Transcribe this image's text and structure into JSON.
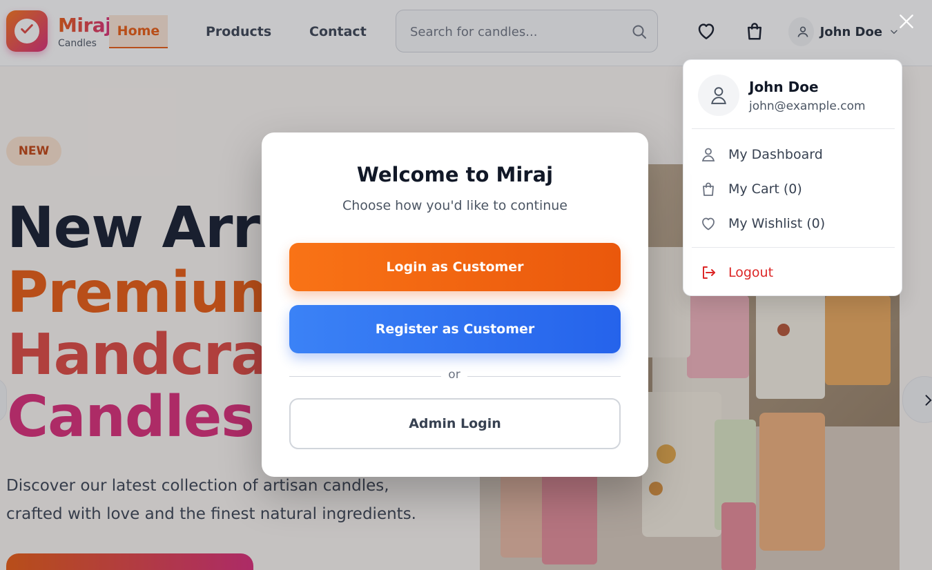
{
  "brand": {
    "name": "Miraj",
    "sub": "Candles"
  },
  "nav": {
    "home": "Home",
    "products": "Products",
    "contact": "Contact"
  },
  "search": {
    "placeholder": "Search for candles..."
  },
  "header": {
    "user_name": "John Doe"
  },
  "hero": {
    "badge": "NEW",
    "line1": "New Arrivals",
    "line2": "Premium",
    "line3": "Handcrafted",
    "line4": "Candles",
    "description": "Discover our latest collection of artisan candles, crafted with love and the finest natural ingredients."
  },
  "dropdown": {
    "name": "John Doe",
    "email": "john@example.com",
    "items": [
      {
        "label": "My Dashboard",
        "icon": "user-icon"
      },
      {
        "label": "My Cart (0)",
        "icon": "bag-icon"
      },
      {
        "label": "My Wishlist (0)",
        "icon": "heart-icon"
      },
      {
        "label": "Logout",
        "icon": "logout-icon"
      }
    ]
  },
  "modal": {
    "title": "Welcome to Miraj",
    "subtitle": "Choose how you'd like to continue",
    "login_label": "Login as Customer",
    "register_label": "Register as Customer",
    "divider_label": "or",
    "admin_label": "Admin Login"
  },
  "colors": {
    "accent": "#ea580c",
    "pink": "#db2777",
    "blue": "#2563eb",
    "logout": "#dc2626"
  }
}
